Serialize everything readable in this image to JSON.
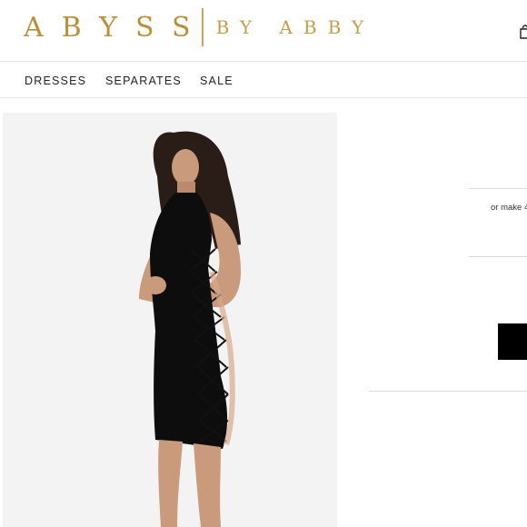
{
  "brand": {
    "main": "ABYSS",
    "sub": "BY ABBY",
    "color": "#b8903a"
  },
  "nav": {
    "items": [
      "DRESSES",
      "SEPARATES",
      "SALE"
    ]
  },
  "product": {
    "image_icon": "product-photo-black-lace-up-midi-dress"
  },
  "payment": {
    "afterpay_text": "or make 4"
  },
  "icons": {
    "cart": "shopping-bag-icon"
  }
}
